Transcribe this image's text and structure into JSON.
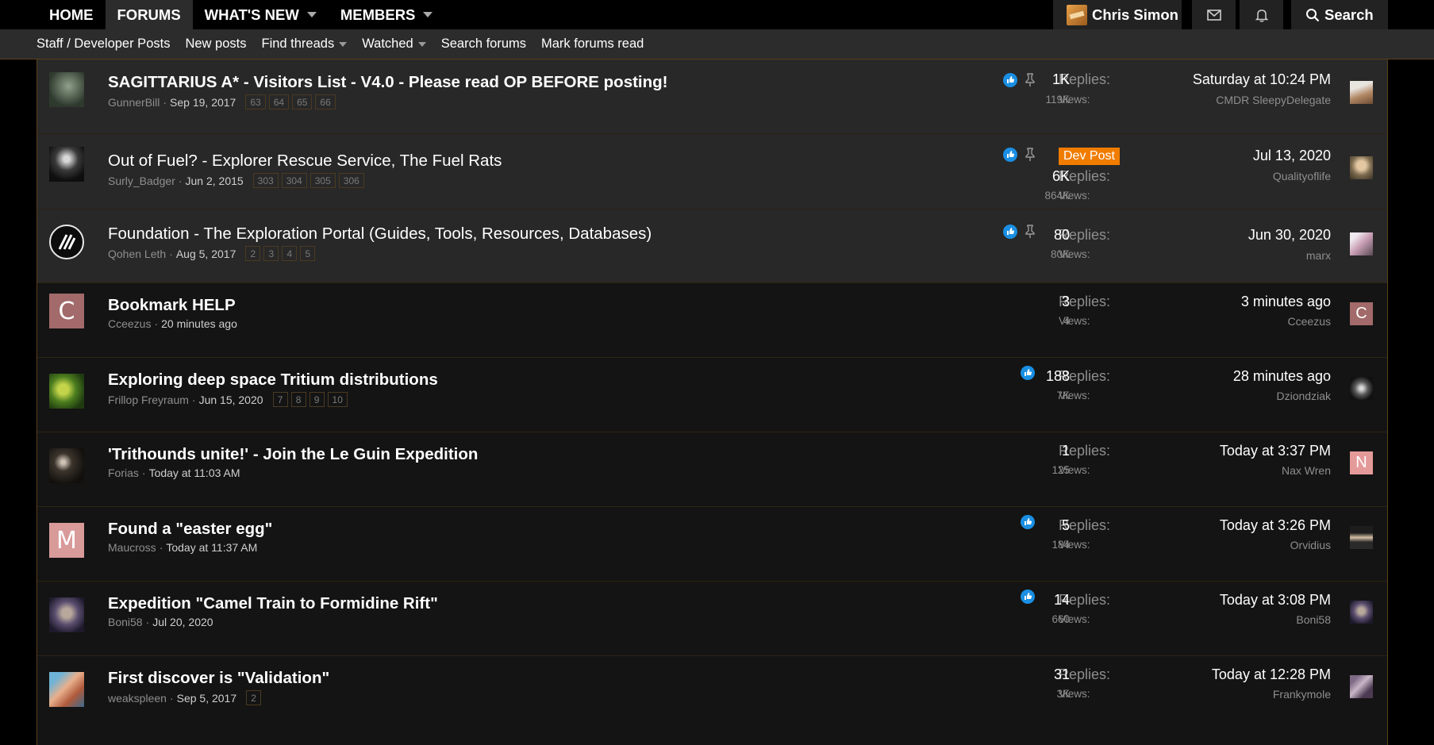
{
  "nav": {
    "tabs": [
      {
        "label": "HOME"
      },
      {
        "label": "FORUMS"
      },
      {
        "label": "WHAT'S NEW"
      },
      {
        "label": "MEMBERS"
      }
    ],
    "user_name": "Chris Simon",
    "search_label": "Search"
  },
  "subnav": {
    "items": [
      {
        "label": "Staff / Developer Posts"
      },
      {
        "label": "New posts"
      },
      {
        "label": "Find threads"
      },
      {
        "label": "Watched"
      },
      {
        "label": "Search forums"
      },
      {
        "label": "Mark forums read"
      }
    ]
  },
  "threads": [
    {
      "title": "SAGITTARIUS A* - Visitors List - V4.0 - Please read OP BEFORE posting!",
      "author": "GunnerBill",
      "date": "Sep 19, 2017",
      "pages": [
        "63",
        "64",
        "65",
        "66"
      ],
      "replies_label": "Replies:",
      "replies": "1K",
      "views_label": "Views:",
      "views": "119K",
      "last_date": "Saturday at 10:24 PM",
      "last_user": "CMDR SleepyDelegate"
    },
    {
      "title": "Out of Fuel? - Explorer Rescue Service, The Fuel Rats",
      "author": "Surly_Badger",
      "date": "Jun 2, 2015",
      "pages": [
        "303",
        "304",
        "305",
        "306"
      ],
      "badge": "Dev Post",
      "replies_label": "Replies:",
      "replies": "6K",
      "views_label": "Views:",
      "views": "864K",
      "last_date": "Jul 13, 2020",
      "last_user": "Qualityoflife"
    },
    {
      "title": "Foundation - The Exploration Portal (Guides, Tools, Resources, Databases)",
      "author": "Qohen Leth",
      "date": "Aug 5, 2017",
      "pages": [
        "2",
        "3",
        "4",
        "5"
      ],
      "replies_label": "Replies:",
      "replies": "80",
      "views_label": "Views:",
      "views": "80K",
      "last_date": "Jun 30, 2020",
      "last_user": "marx"
    },
    {
      "title": "Bookmark HELP",
      "author": "Cceezus",
      "date": "20 minutes ago",
      "pages": [],
      "avatar_letter": "C",
      "replies_label": "Replies:",
      "replies": "3",
      "views_label": "Views:",
      "views": "4",
      "last_date": "3 minutes ago",
      "last_user": "Cceezus",
      "last_avatar_letter": "C"
    },
    {
      "title": "Exploring deep space Tritium distributions",
      "author": "Frillop Freyraum",
      "date": "Jun 15, 2020",
      "pages": [
        "7",
        "8",
        "9",
        "10"
      ],
      "replies_label": "Replies:",
      "replies": "188",
      "views_label": "Views:",
      "views": "7K",
      "last_date": "28 minutes ago",
      "last_user": "Dziondziak"
    },
    {
      "title": "'Trithounds unite!' - Join the Le Guin Expedition",
      "author": "Forias",
      "date": "Today at 11:03 AM",
      "pages": [],
      "replies_label": "Replies:",
      "replies": "1",
      "views_label": "Views:",
      "views": "125",
      "last_date": "Today at 3:37 PM",
      "last_user": "Nax Wren",
      "last_avatar_letter": "N"
    },
    {
      "title": "Found a \"easter egg\"",
      "author": "Maucross",
      "date": "Today at 11:37 AM",
      "pages": [],
      "avatar_letter": "M",
      "replies_label": "Replies:",
      "replies": "5",
      "views_label": "Views:",
      "views": "184",
      "last_date": "Today at 3:26 PM",
      "last_user": "Orvidius"
    },
    {
      "title": "Expedition \"Camel Train to Formidine Rift\"",
      "author": "Boni58",
      "date": "Jul 20, 2020",
      "pages": [],
      "replies_label": "Replies:",
      "replies": "14",
      "views_label": "Views:",
      "views": "660",
      "last_date": "Today at 3:08 PM",
      "last_user": "Boni58"
    },
    {
      "title": "First discover is \"Validation\"",
      "author": "weakspleen",
      "date": "Sep 5, 2017",
      "pages": [
        "2"
      ],
      "replies_label": "Replies:",
      "replies": "31",
      "views_label": "Views:",
      "views": "3K",
      "last_date": "Today at 12:28 PM",
      "last_user": "Frankymole"
    }
  ],
  "colors": {
    "accent_orange": "#f07c00",
    "like_blue": "#1a8fe3",
    "border": "#5a3f1a"
  }
}
